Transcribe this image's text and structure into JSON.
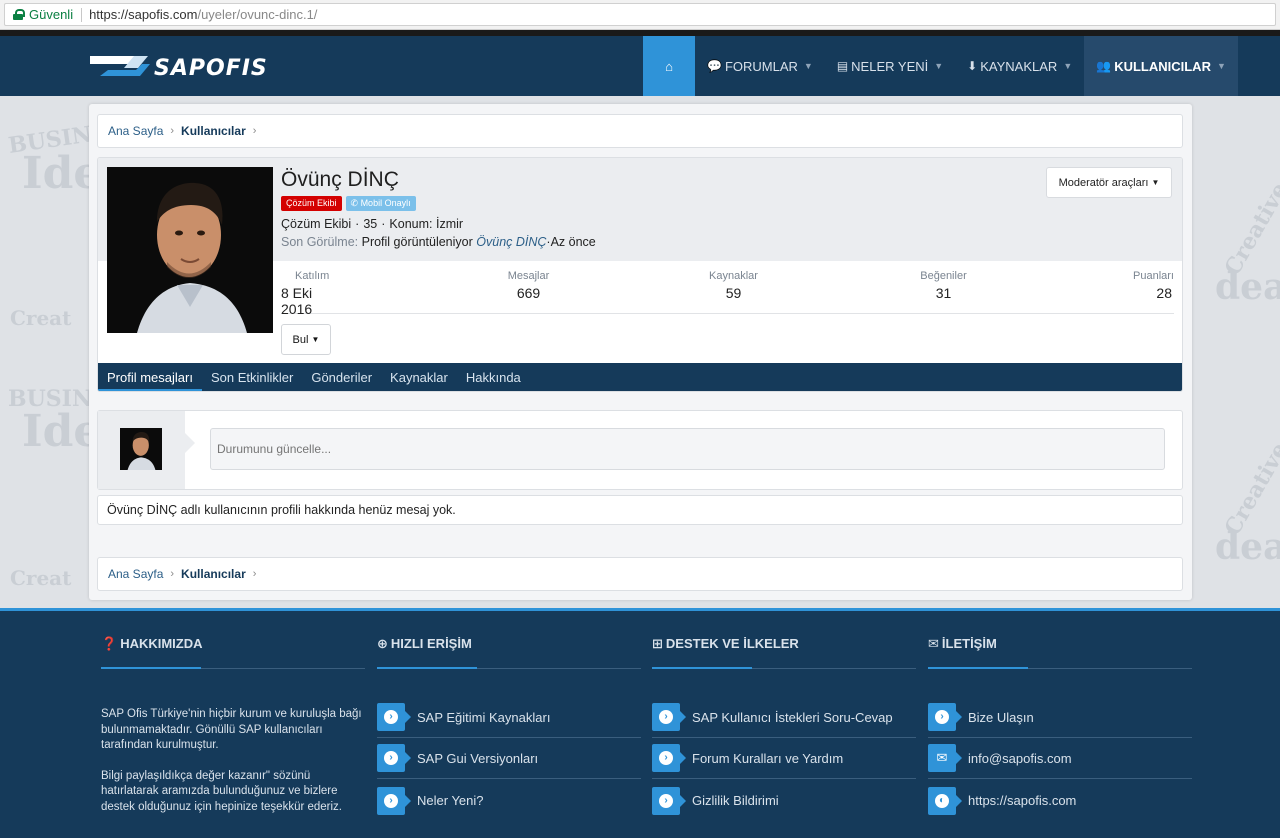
{
  "browser": {
    "secure_label": "Güvenli",
    "url_base": "https://sapofis.com",
    "url_path": "/uyeler/ovunc-dinc.1/"
  },
  "header": {
    "logo_text": "SAPOFIS",
    "nav": [
      {
        "label": "FORUMLAR",
        "icon": "comments-icon"
      },
      {
        "label": "NELER YENİ",
        "icon": "newspaper-icon"
      },
      {
        "label": "KAYNAKLAR",
        "icon": "download-icon"
      },
      {
        "label": "KULLANICILAR",
        "icon": "users-icon"
      }
    ]
  },
  "breadcrumb": {
    "home": "Ana Sayfa",
    "current": "Kullanıcılar"
  },
  "profile": {
    "name": "Övünç DİNÇ",
    "badge_team": "Çözüm Ekibi",
    "badge_mobile": "Mobil Onaylı",
    "role": "Çözüm Ekibi",
    "age": "35",
    "location_label": "Konum:",
    "location": "İzmir",
    "last_seen_label": "Son Görülme:",
    "last_seen_activity": "Profil görüntüleniyor",
    "last_seen_user": "Övünç DİNÇ",
    "last_seen_time": "Az önce",
    "moderator_button": "Moderatör araçları",
    "find_button": "Bul",
    "stats": [
      {
        "label": "Katılım",
        "value": "8 Eki 2016"
      },
      {
        "label": "Mesajlar",
        "value": "669"
      },
      {
        "label": "Kaynaklar",
        "value": "59"
      },
      {
        "label": "Beğeniler",
        "value": "31"
      },
      {
        "label": "Puanları",
        "value": "28"
      }
    ],
    "tabs": [
      "Profil mesajları",
      "Son Etkinlikler",
      "Gönderiler",
      "Kaynaklar",
      "Hakkında"
    ]
  },
  "status": {
    "placeholder": "Durumunu güncelle...",
    "empty_message": "Övünç DİNÇ adlı kullanıcının profili hakkında henüz mesaj yok."
  },
  "footer": {
    "about": {
      "title": "HAKKIMIZDA",
      "p1": "SAP Ofis Türkiye'nin hiçbir kurum ve kuruluşla bağı bulunmamaktadır. Gönüllü SAP kullanıcıları tarafından kurulmuştur.",
      "p2": "Bilgi paylaşıldıkça değer kazanır\" sözünü hatırlatarak aramızda bulunduğunuz ve bizlere destek olduğunuz için hepinize teşekkür ederiz."
    },
    "quick": {
      "title": "HIZLI ERİŞİM",
      "links": [
        "SAP Eğitimi Kaynakları",
        "SAP Gui Versiyonları",
        "Neler Yeni?"
      ]
    },
    "support": {
      "title": "DESTEK VE İLKELER",
      "links": [
        "SAP Kullanıcı İstekleri Soru-Cevap",
        "Forum Kuralları ve Yardım",
        "Gizlilik Bildirimi"
      ]
    },
    "contact": {
      "title": "İLETİŞİM",
      "links": [
        "Bize Ulaşın",
        "info@sapofis.com",
        "https://sapofis.com"
      ]
    }
  },
  "colors": {
    "brand_dark": "#153a5a",
    "accent": "#2f93d8",
    "badge_red": "#d40000",
    "badge_blue": "#7bc0ea"
  }
}
